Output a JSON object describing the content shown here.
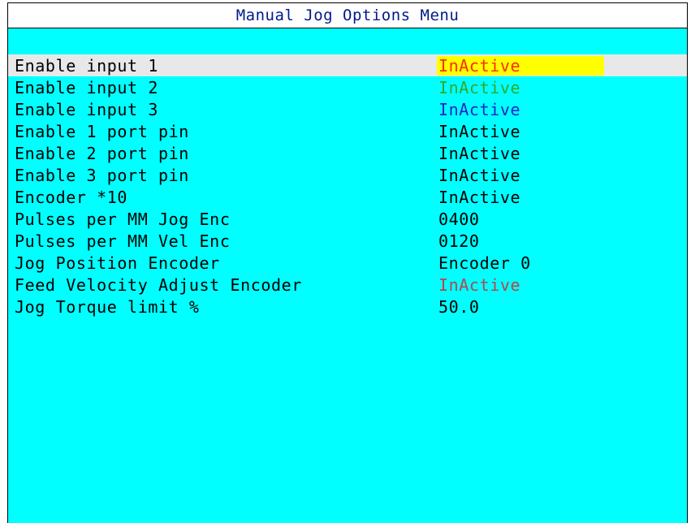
{
  "title": "Manual Jog Options Menu",
  "colors": {
    "screen_bg": "#00ffff",
    "title_text": "#001a8c",
    "selected_row_bg": "#e8e8e8",
    "highlight_value_bg": "#ffff00",
    "value_red": "#ff2a00",
    "value_green": "#2eaa2e",
    "value_blue": "#1f23c8",
    "value_maroon": "#b5464b",
    "value_black": "#000000"
  },
  "rows": [
    {
      "label": "Enable input 1",
      "value": "InActive",
      "value_color": "#ff2a00",
      "selected": true
    },
    {
      "label": "Enable input 2",
      "value": "InActive",
      "value_color": "#2eaa2e"
    },
    {
      "label": "Enable input 3",
      "value": "InActive",
      "value_color": "#1f23c8"
    },
    {
      "label": "Enable 1 port pin",
      "value": "InActive",
      "value_color": "#000000"
    },
    {
      "label": "Enable 2 port pin",
      "value": "InActive",
      "value_color": "#000000"
    },
    {
      "label": "Enable 3 port pin",
      "value": "InActive",
      "value_color": "#000000"
    },
    {
      "label": "Encoder *10",
      "value": "InActive",
      "value_color": "#000000"
    },
    {
      "label": "Pulses per MM Jog Enc",
      "value": "0400",
      "value_color": "#000000"
    },
    {
      "label": "Pulses per MM Vel Enc",
      "value": "0120",
      "value_color": "#000000"
    },
    {
      "label": "Jog Position Encoder",
      "value": "Encoder 0",
      "value_color": "#000000"
    },
    {
      "label": "Feed Velocity Adjust Encoder",
      "value": "InActive",
      "value_color": "#b5464b"
    },
    {
      "label": "Jog Torque limit %",
      "value": "50.0",
      "value_color": "#000000"
    }
  ]
}
